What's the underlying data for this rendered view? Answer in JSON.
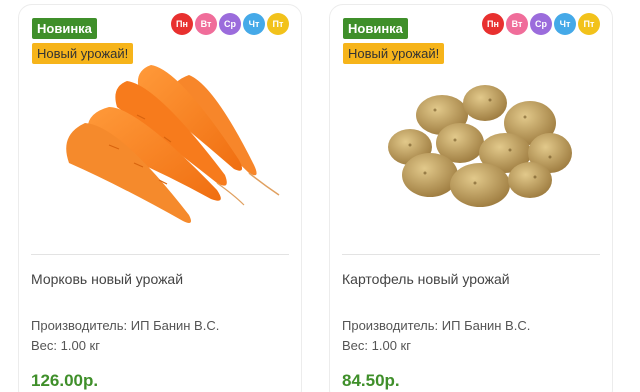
{
  "products": [
    {
      "badge_new": "Новинка",
      "badge_harvest": "Новый урожай!",
      "days": [
        {
          "label": "Пн",
          "color": "#e8302f"
        },
        {
          "label": "Вт",
          "color": "#f06d9a"
        },
        {
          "label": "Ср",
          "color": "#9b6cdc"
        },
        {
          "label": "Чт",
          "color": "#45a9e8"
        },
        {
          "label": "Пт",
          "color": "#f2c21b"
        }
      ],
      "image_icon": "carrot-image",
      "name": "Морковь новый урожай",
      "maker": "Производитель: ИП Банин В.С.",
      "weight": "Вес: 1.00 кг",
      "price": "126.00р."
    },
    {
      "badge_new": "Новинка",
      "badge_harvest": "Новый урожай!",
      "days": [
        {
          "label": "Пн",
          "color": "#e8302f"
        },
        {
          "label": "Вт",
          "color": "#f06d9a"
        },
        {
          "label": "Ср",
          "color": "#9b6cdc"
        },
        {
          "label": "Чт",
          "color": "#45a9e8"
        },
        {
          "label": "Пт",
          "color": "#f2c21b"
        }
      ],
      "image_icon": "potato-image",
      "name": "Картофель новый урожай",
      "maker": "Производитель: ИП Банин В.С.",
      "weight": "Вес: 1.00 кг",
      "price": "84.50р."
    }
  ],
  "colors": {
    "accent_green": "#3f8f2a",
    "harvest_yellow": "#f6b41a"
  }
}
